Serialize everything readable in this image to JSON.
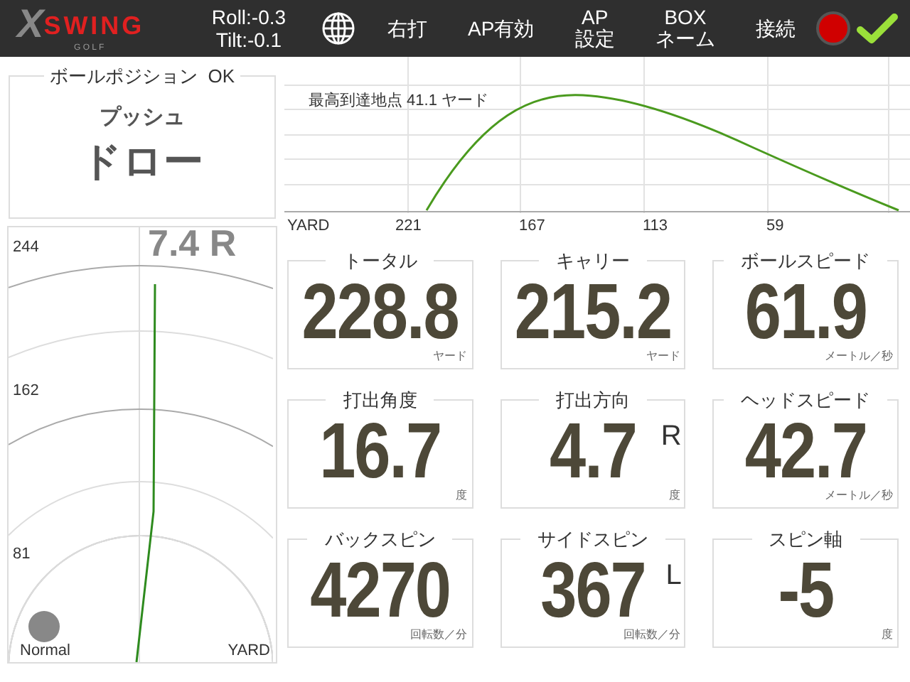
{
  "top_bar": {
    "logo": {
      "mark": "X",
      "word": "SWING",
      "sub": "G O L F"
    },
    "roll": "Roll:-0.3",
    "tilt": "Tilt:-0.1",
    "menu": [
      {
        "lines": [
          "右打"
        ]
      },
      {
        "lines": [
          "AP有効"
        ]
      },
      {
        "lines": [
          "AP",
          "設定"
        ]
      },
      {
        "lines": [
          "BOX",
          "ネーム"
        ]
      },
      {
        "lines": [
          "接続"
        ]
      }
    ],
    "status_light": {
      "on": true
    },
    "check": {
      "ok": true
    }
  },
  "ball_position": {
    "title": "ボールポジション  OK",
    "direction": "プッシュ",
    "shape": "ドロー"
  },
  "trajectory": {
    "peak_label": "最高到達地点 41.1 ヤード",
    "unit": "YARD",
    "x_labels": [
      "221",
      "167",
      "113",
      "59"
    ]
  },
  "dispersion": {
    "offset": "7.4 R",
    "distance_labels": [
      "244",
      "162",
      "81"
    ],
    "club": "Normal",
    "unit": "YARD"
  },
  "stats": [
    {
      "title": "トータル",
      "value": "228.8",
      "unit": "ヤード"
    },
    {
      "title": "キャリー",
      "value": "215.2",
      "unit": "ヤード"
    },
    {
      "title": "ボールスピード",
      "value": "61.9",
      "unit": "メートル／秒"
    },
    {
      "title": "打出角度",
      "value": "16.7",
      "unit": "度"
    },
    {
      "title": "打出方向",
      "value": "4.7",
      "unit": "度",
      "side": "R"
    },
    {
      "title": "ヘッドスピード",
      "value": "42.7",
      "unit": "メートル／秒"
    },
    {
      "title": "バックスピン",
      "value": "4270",
      "unit": "回転数／分"
    },
    {
      "title": "サイドスピン",
      "value": "367",
      "unit": "回転数／分",
      "side": "L"
    },
    {
      "title": "スピン軸",
      "value": "-5",
      "unit": "度"
    }
  ]
}
